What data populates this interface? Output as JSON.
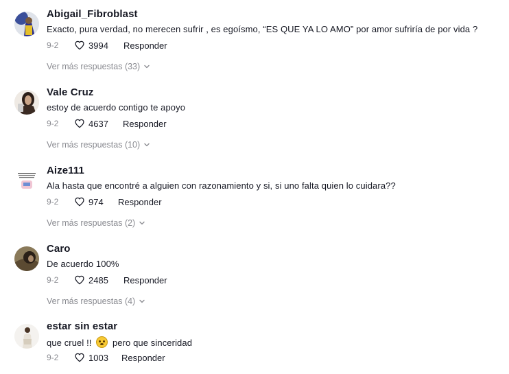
{
  "comments": [
    {
      "username": "Abigail_Fibroblast",
      "text": "Exacto, pura verdad, no merecen sufrir , es egoísmo, “ES QUE YA LO AMO” por amor sufriría de por vida ?",
      "date": "9-2",
      "likes": "3994",
      "reply_label": "Responder",
      "more_replies": "Ver más respuestas (33)"
    },
    {
      "username": "Vale Cruz",
      "text": "estoy de acuerdo contigo te apoyo",
      "date": "9-2",
      "likes": "4637",
      "reply_label": "Responder",
      "more_replies": "Ver más respuestas (10)"
    },
    {
      "username": "Aize111",
      "text": "Ala hasta que encontré a alguien con razonamiento y si, si uno falta quien lo cuidara??",
      "date": "9-2",
      "likes": "974",
      "reply_label": "Responder",
      "more_replies": "Ver más respuestas (2)"
    },
    {
      "username": "Caro",
      "text": "De acuerdo 100%",
      "date": "9-2",
      "likes": "2485",
      "reply_label": "Responder",
      "more_replies": "Ver más respuestas (4)"
    },
    {
      "username": "estar sin estar",
      "text_before": "que cruel !!",
      "text_after": "pero que sinceridad",
      "date": "9-2",
      "likes": "1003",
      "reply_label": "Responder"
    }
  ],
  "icons": {
    "like": "heart-outline-icon",
    "expand": "chevron-down-icon",
    "emoji": "flushed-face-emoji"
  }
}
